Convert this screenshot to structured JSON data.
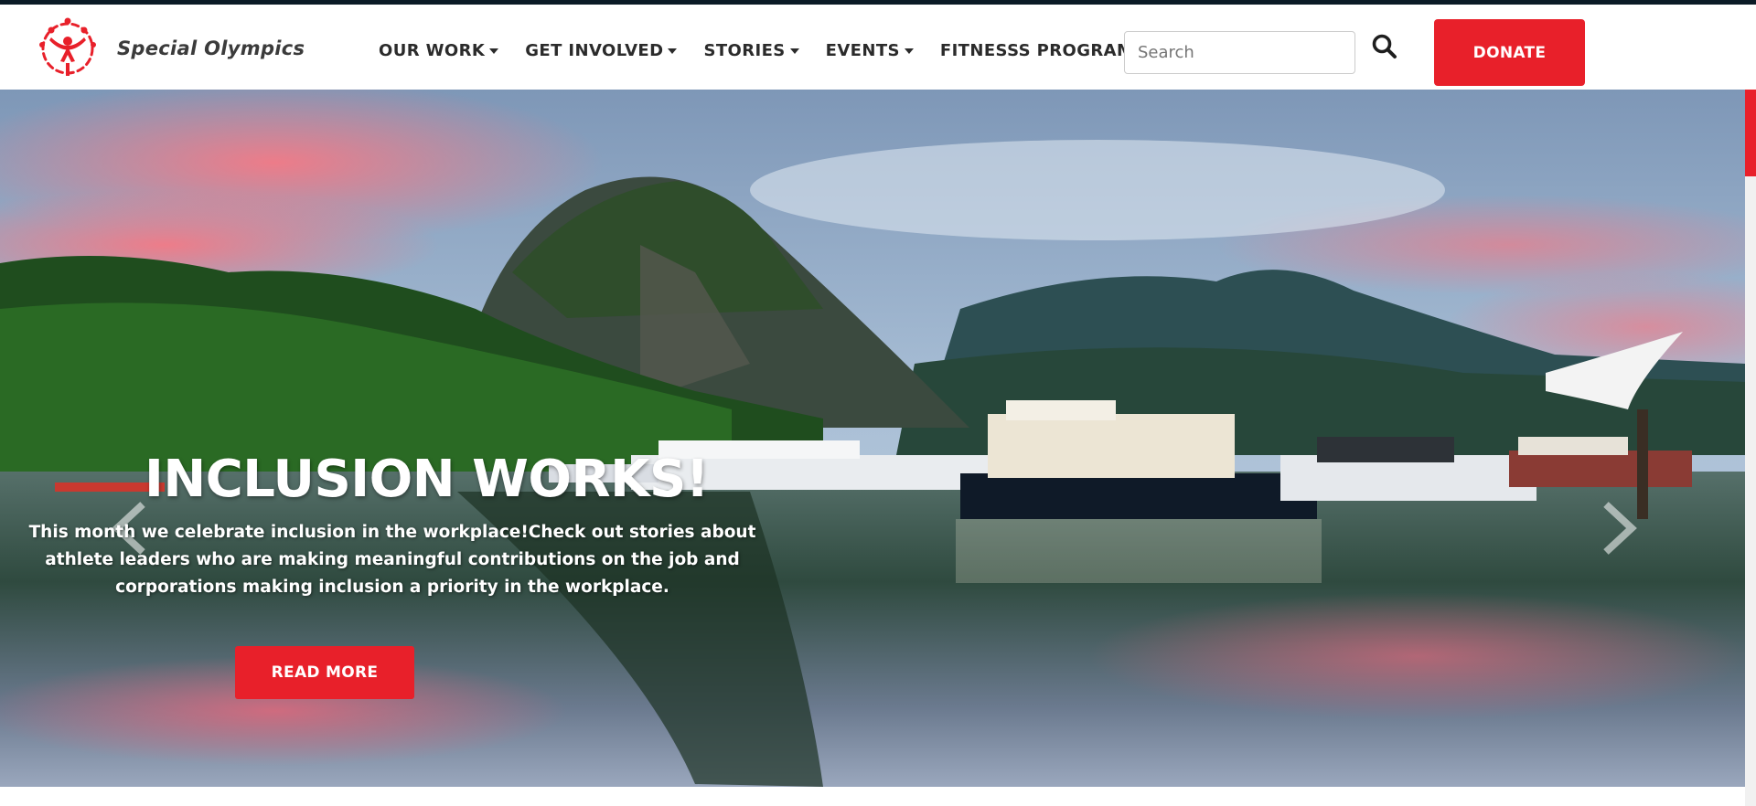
{
  "brand": {
    "name": "Special Olympics",
    "accent_color": "#e8202a"
  },
  "nav": {
    "items": [
      {
        "label": "OUR WORK"
      },
      {
        "label": "GET INVOLVED"
      },
      {
        "label": "STORIES"
      },
      {
        "label": "EVENTS"
      },
      {
        "label": "FITNESSS PROGRAM"
      }
    ]
  },
  "search": {
    "placeholder": "Search",
    "icon": "search-icon"
  },
  "donate": {
    "label": "DONATE"
  },
  "hero": {
    "title": "INCLUSION WORKS!",
    "text": "This month we celebrate inclusion in the workplace!Check out stories about athlete leaders who are making meaningful contributions on the job and corporations making inclusion a priority in the workplace.",
    "button_label": "READ MORE",
    "prev_icon": "chevron-left-icon",
    "next_icon": "chevron-right-icon"
  }
}
